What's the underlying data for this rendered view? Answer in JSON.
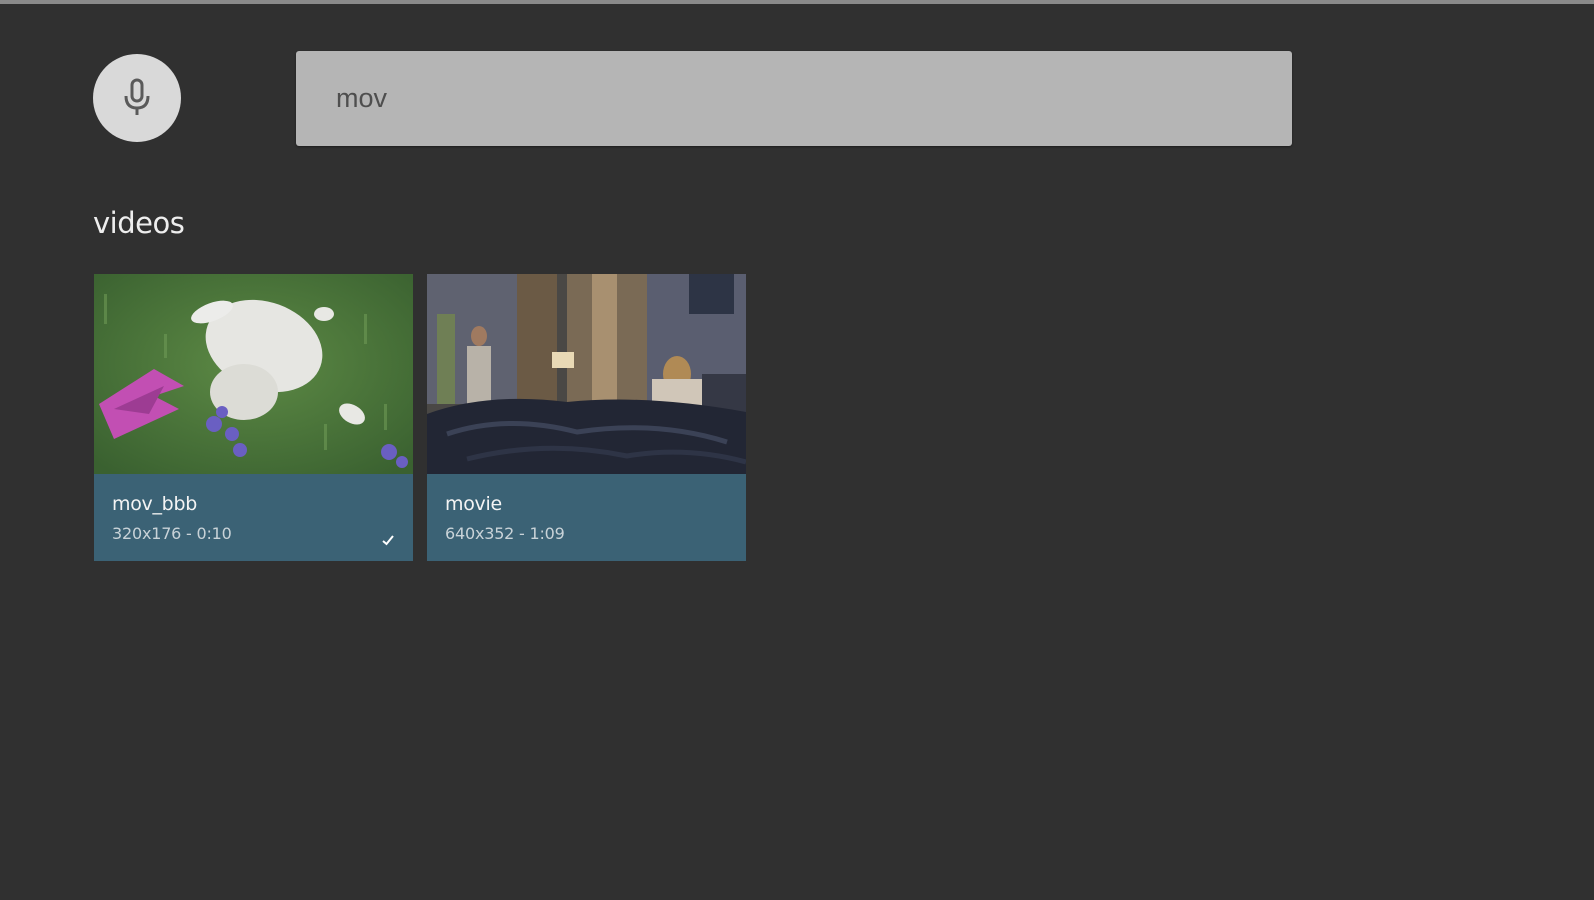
{
  "search": {
    "query": "mov",
    "mic_icon": "microphone-icon"
  },
  "results": {
    "row_header": "videos",
    "items": [
      {
        "title": "mov_bbb",
        "subtitle": "320x176 - 0:10",
        "thumbnail": "rabbit-in-grass-thumbnail",
        "watched_icon": "check-icon"
      },
      {
        "title": "movie",
        "subtitle": "640x352 - 1:09",
        "thumbnail": "bedroom-scene-thumbnail"
      }
    ]
  },
  "colors": {
    "background": "#303030",
    "search_box": "#b5b5b5",
    "card_info": "#3b6275",
    "mic_button": "#d9d9d9"
  }
}
